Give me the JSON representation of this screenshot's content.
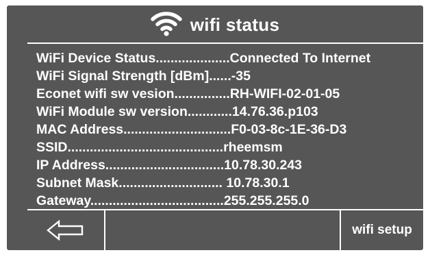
{
  "header": {
    "icon": "wifi-icon",
    "title": "wifi status"
  },
  "rows": [
    {
      "label": "WiFi Device Status....................",
      "value": "Connected To Internet"
    },
    {
      "label": "WiFi Signal Strength [dBm]......",
      "value": "-35"
    },
    {
      "label": "Econet wifi sw vesion...............",
      "value": "RH-WIFI-02-01-05"
    },
    {
      "label": "WiFi Module sw version............",
      "value": "14.76.36.p103"
    },
    {
      "label": "MAC Address.............................",
      "value": "F0-03-8c-1E-36-D3"
    },
    {
      "label": "SSID..........................................",
      "value": "rheemsm"
    },
    {
      "label": "IP Address................................",
      "value": "10.78.30.243"
    },
    {
      "label": "Subnet Mask............................",
      "value": " 10.78.30.1"
    },
    {
      "label": "Gateway....................................",
      "value": "255.255.255.0"
    }
  ],
  "footer": {
    "back_icon": "left-arrow-icon",
    "wifi_setup_label": "wifi setup"
  },
  "colors": {
    "panel": "#565656",
    "text": "#ffffff"
  }
}
